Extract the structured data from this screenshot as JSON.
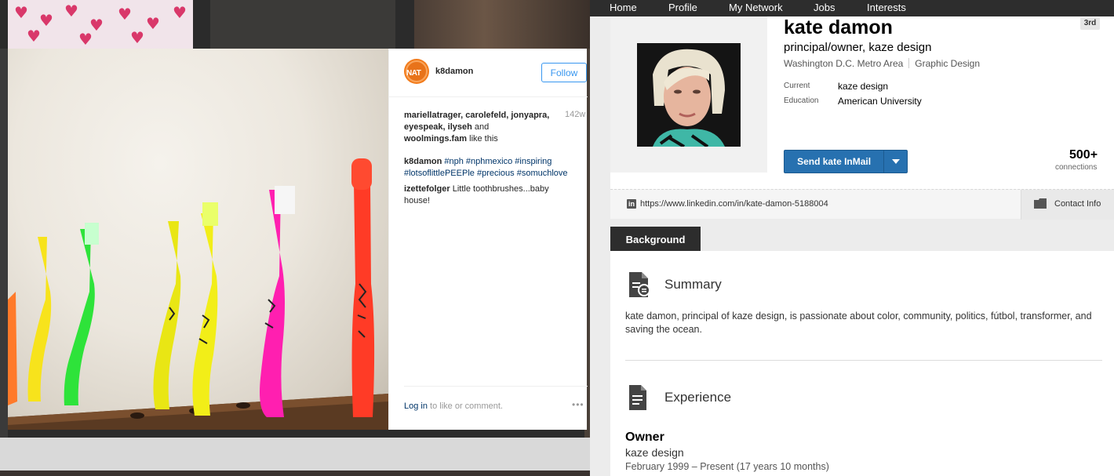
{
  "instagram": {
    "username": "k8damon",
    "avatar_text": "NAT",
    "follow_label": "Follow",
    "likes": {
      "names": [
        "mariellatrager",
        "carolefeld",
        "jonyapra",
        "eyespeak",
        "ilyseh",
        "woolmings.fam"
      ],
      "suffix": "like this",
      "line1": "mariellatrager, carolefeld, jonyapra,",
      "line2a": "eyespeak, ilyseh",
      "line2b": " and",
      "line3a": "woolmings.fam",
      "line3b": " like this"
    },
    "age": "142w",
    "caption": {
      "author": "k8damon",
      "tags": [
        "#nph",
        "#nphmexico",
        "#inspiring",
        "#lotsoflittlePEEPle",
        "#precious",
        "#somuchlove"
      ]
    },
    "comment": {
      "author": "izettefolger",
      "text": "Little toothbrushes...baby house!"
    },
    "footer": {
      "login_link": "Log in",
      "login_text": " to like or comment.",
      "more": "•••"
    },
    "photo_icon": "toothbrushes-photo"
  },
  "linkedin": {
    "nav": [
      "Home",
      "Profile",
      "My Network",
      "Jobs",
      "Interests"
    ],
    "name": "kate damon",
    "degree": "3rd",
    "headline": "principal/owner, kaze design",
    "location": "Washington D.C. Metro Area",
    "industry": "Graphic Design",
    "current_label": "Current",
    "current_value": "kaze design",
    "education_label": "Education",
    "education_value": "American University",
    "inmail_label": "Send kate InMail",
    "connections_count": "500+",
    "connections_label": "connections",
    "profile_url": "https://www.linkedin.com/in/kate-damon-5188004",
    "contact_info": "Contact Info",
    "background_tab": "Background",
    "summary_title": "Summary",
    "summary_text": "kate damon, principal of kaze design, is passionate about color, community, politics, fútbol, transformer, and saving the ocean.",
    "experience_title": "Experience",
    "experience": {
      "title": "Owner",
      "company": "kaze design",
      "dates": "February 1999 – Present (17 years 10 months)"
    },
    "accent_color": "#2771b0"
  }
}
